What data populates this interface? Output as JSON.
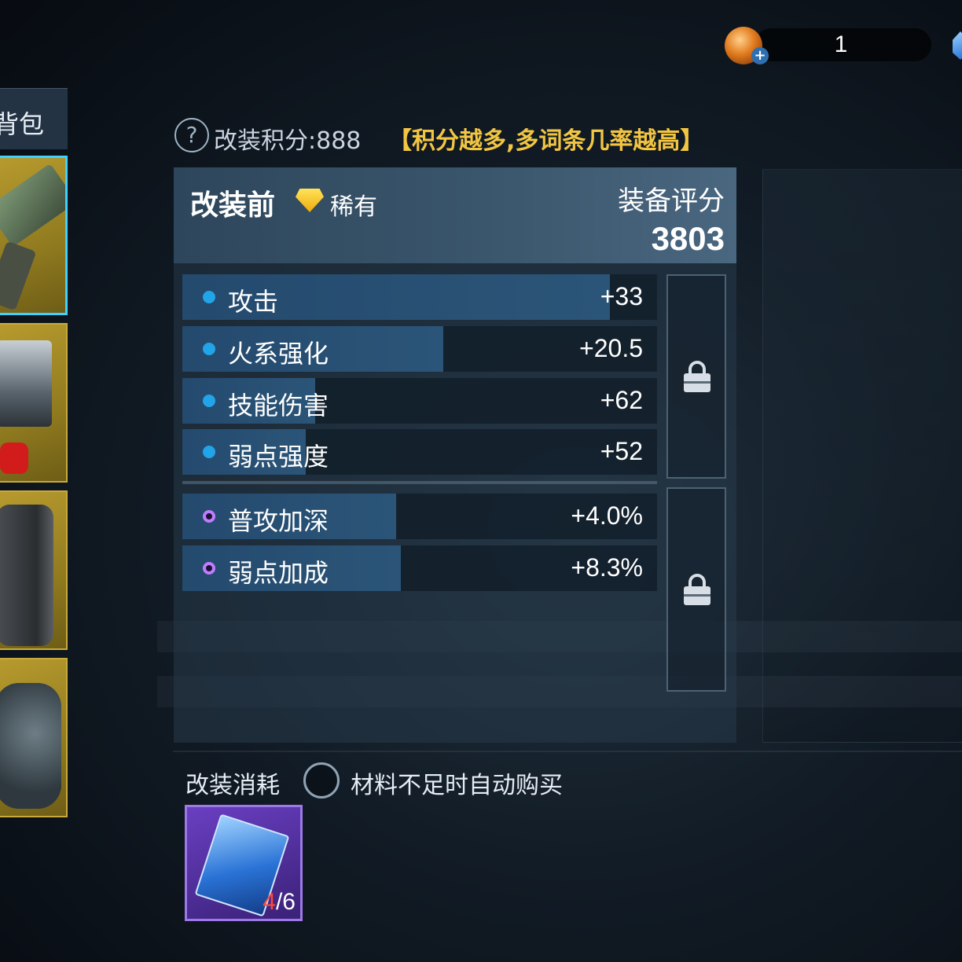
{
  "currency": {
    "amount": "1",
    "plus_symbol": "+"
  },
  "sidebar": {
    "bag_label": "背包",
    "slots": [
      {
        "name": "gun",
        "selected": true
      },
      {
        "name": "chest-armor",
        "selected": false
      },
      {
        "name": "leg-armor",
        "selected": false
      },
      {
        "name": "gauntlet",
        "selected": false
      }
    ]
  },
  "header": {
    "help_symbol": "?",
    "points_label": "改装积分:888",
    "points_hint": "【积分越多,多词条几率越高】"
  },
  "card": {
    "title": "改装前",
    "rarity": "稀有",
    "rarity_color": "#f5c518",
    "score_label": "装备评分",
    "score_value": "3803"
  },
  "stats": {
    "base": [
      {
        "name": "攻击",
        "value": "+33",
        "fill": 0.9
      },
      {
        "name": "火系强化",
        "value": "+20.5",
        "fill": 0.55
      },
      {
        "name": "技能伤害",
        "value": "+62",
        "fill": 0.28
      },
      {
        "name": "弱点强度",
        "value": "+52",
        "fill": 0.26
      }
    ],
    "special": [
      {
        "name": "普攻加深",
        "value": "+4.0%",
        "fill": 0.45
      },
      {
        "name": "弱点加成",
        "value": "+8.3%",
        "fill": 0.46
      }
    ]
  },
  "cost": {
    "label": "改装消耗",
    "auto_buy_label": "材料不足时自动购买",
    "material_have": "4",
    "material_need": "/6"
  },
  "colors": {
    "accent_cyan": "#3fd2ff",
    "gold_hint": "#f2c542",
    "purple_item": "#6a3fc2"
  }
}
